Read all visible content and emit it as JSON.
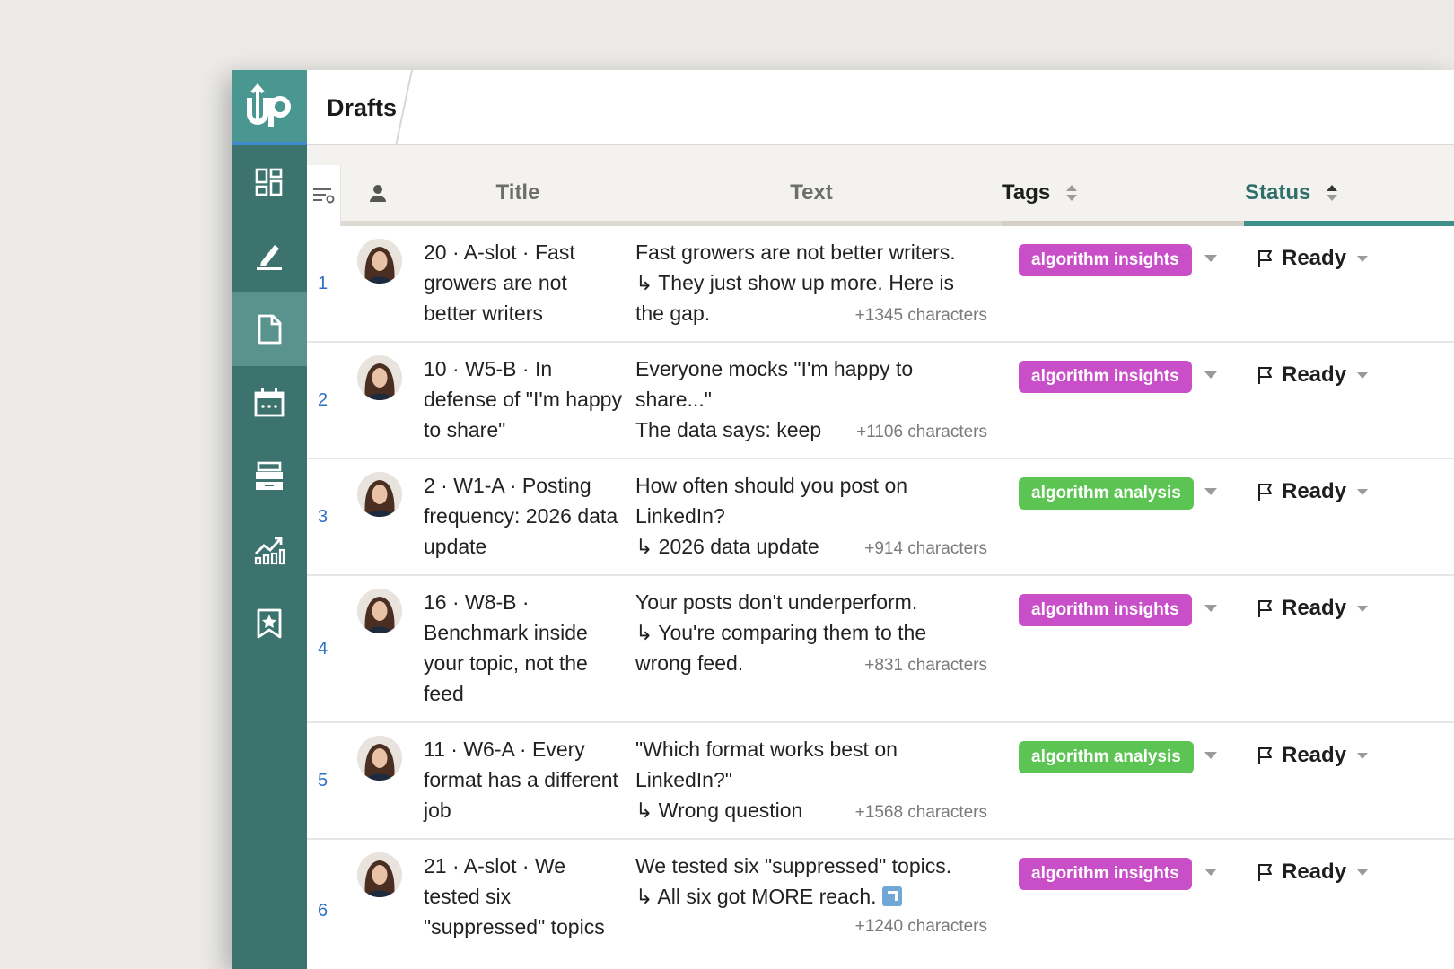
{
  "app": {
    "logo_text": "up",
    "accent": "#3d736f",
    "brand_light": "#4a9691"
  },
  "header": {
    "tab_title": "Drafts"
  },
  "sidebar": {
    "items": [
      {
        "name": "dashboard-icon",
        "active": false
      },
      {
        "name": "compose-icon",
        "active": false
      },
      {
        "name": "drafts-icon",
        "active": true
      },
      {
        "name": "calendar-icon",
        "active": false
      },
      {
        "name": "archive-icon",
        "active": false
      },
      {
        "name": "analytics-icon",
        "active": false
      },
      {
        "name": "bookmark-icon",
        "active": false
      }
    ]
  },
  "table": {
    "columns": {
      "title": "Title",
      "text": "Text",
      "tags": "Tags",
      "status": "Status"
    },
    "tag_colors": {
      "algorithm insights": "#c94fc9",
      "algorithm analysis": "#5cc452"
    },
    "rows": [
      {
        "num": "1",
        "title": "20 · A-slot · Fast growers are not better writers",
        "text_lines": [
          "Fast growers are not better writers.",
          "↳ They just show up more. Here is",
          "the gap."
        ],
        "chars": "+1345 characters",
        "tag": "algorithm insights",
        "status": "Ready"
      },
      {
        "num": "2",
        "title": "10 · W5-B · In defense of \"I'm happy to share\"",
        "text_lines": [
          "Everyone mocks \"I'm happy to",
          "share...\"",
          "The data says: keep"
        ],
        "chars": "+1106 characters",
        "tag": "algorithm insights",
        "status": "Ready"
      },
      {
        "num": "3",
        "title": "2 · W1-A · Posting frequency: 2026 data update",
        "text_lines": [
          "How often should you post on",
          "LinkedIn?",
          "↳ 2026 data update"
        ],
        "chars": "+914 characters",
        "tag": "algorithm analysis",
        "status": "Ready"
      },
      {
        "num": "4",
        "title": "16 · W8-B · Benchmark inside your topic, not the feed",
        "text_lines": [
          "Your posts don't underperform.",
          "↳ You're comparing them to the",
          "wrong feed."
        ],
        "chars": "+831 characters",
        "tag": "algorithm insights",
        "status": "Ready"
      },
      {
        "num": "5",
        "title": "11 · W6-A · Every format has a different job",
        "text_lines": [
          "\"Which format works best on",
          "LinkedIn?\"",
          "↳ Wrong question"
        ],
        "chars": "+1568 characters",
        "tag": "algorithm analysis",
        "status": "Ready"
      },
      {
        "num": "6",
        "title": "21 · A-slot · We tested six \"suppressed\" topics",
        "text_lines": [
          "We tested six \"suppressed\" topics.",
          "↳ All six got MORE reach."
        ],
        "chars": "+1240 characters",
        "tag": "algorithm insights",
        "status": "Ready"
      }
    ]
  }
}
